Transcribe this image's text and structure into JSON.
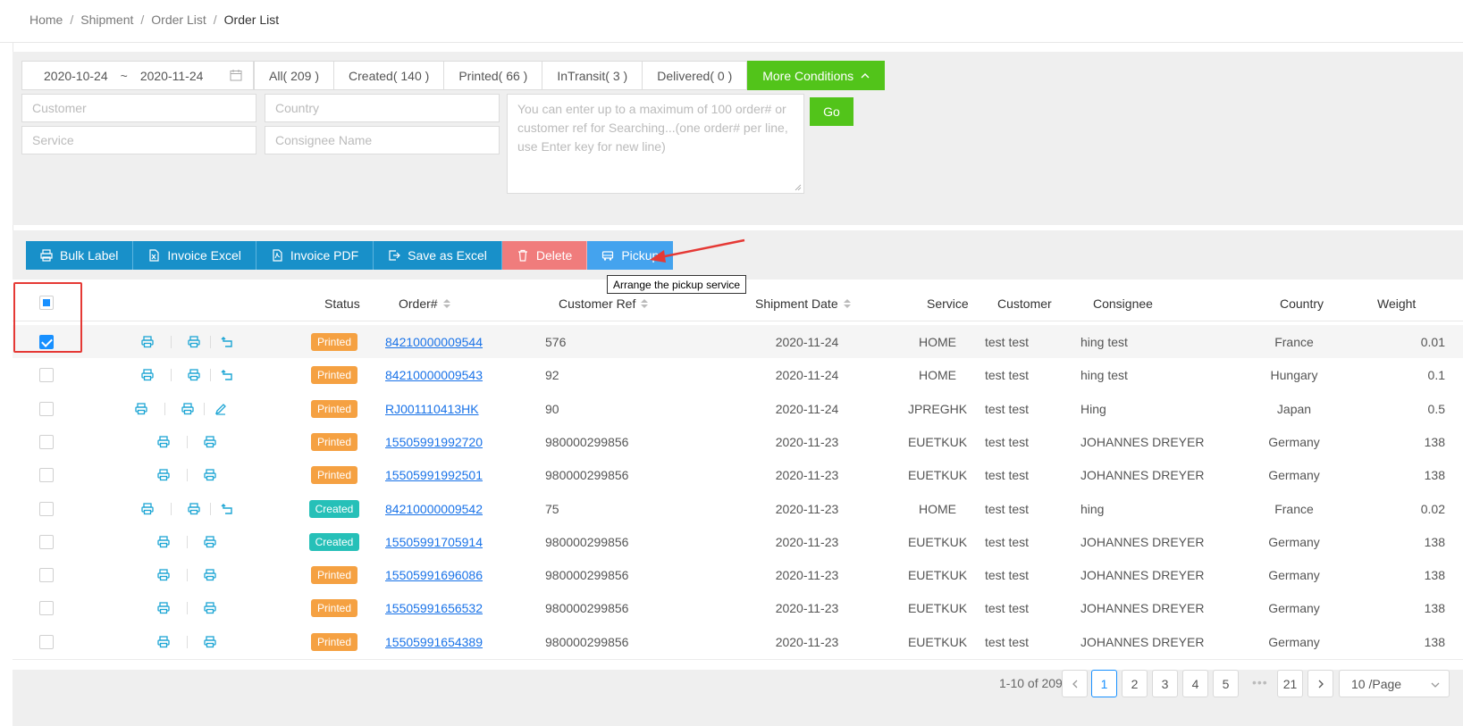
{
  "breadcrumb": [
    "Home",
    "Shipment",
    "Order List",
    "Order List"
  ],
  "filters": {
    "date_start": "2020-10-24",
    "date_sep": "~",
    "date_end": "2020-11-24",
    "tabs": [
      {
        "label": "All( 209 )"
      },
      {
        "label": "Created( 140 )"
      },
      {
        "label": "Printed( 66 )"
      },
      {
        "label": "InTransit( 3 )"
      },
      {
        "label": "Delivered( 0 )"
      }
    ],
    "more_label": "More Conditions",
    "customer_placeholder": "Customer",
    "country_placeholder": "Country",
    "service_placeholder": "Service",
    "consignee_placeholder": "Consignee Name",
    "search_placeholder": "You can enter up to a maximum of 100 order# or customer ref for Searching...(one order# per line, use Enter key for new line)",
    "go_label": "Go"
  },
  "toolbar": {
    "bulk_label": "Bulk Label",
    "invoice_excel": "Invoice Excel",
    "invoice_pdf": "Invoice PDF",
    "save_excel": "Save as Excel",
    "delete": "Delete",
    "pickup": "Pickup"
  },
  "tooltip": "Arrange the pickup service",
  "columns": {
    "status": "Status",
    "order": "Order#",
    "customer_ref": "Customer Ref",
    "shipment_date": "Shipment Date",
    "service": "Service",
    "customer": "Customer",
    "consignee": "Consignee",
    "country": "Country",
    "weight": "Weight"
  },
  "rows": [
    {
      "checked": true,
      "actions": "print-print-return",
      "status": "Printed",
      "order": "84210000009544",
      "ref": "576",
      "date": "2020-11-24",
      "service": "HOME",
      "customer": "test test",
      "consignee": "hing test",
      "country": "France",
      "weight": "0.01"
    },
    {
      "checked": false,
      "actions": "print-print-return",
      "status": "Printed",
      "order": "84210000009543",
      "ref": "92",
      "date": "2020-11-24",
      "service": "HOME",
      "customer": "test test",
      "consignee": "hing test",
      "country": "Hungary",
      "weight": "0.1"
    },
    {
      "checked": false,
      "actions": "print-print-edit",
      "status": "Printed",
      "order": "RJ001110413HK",
      "ref": "90",
      "date": "2020-11-24",
      "service": "JPREGHK",
      "customer": "test test",
      "consignee": "Hing",
      "country": "Japan",
      "weight": "0.5"
    },
    {
      "checked": false,
      "actions": "print-print",
      "status": "Printed",
      "order": "15505991992720",
      "ref": "980000299856",
      "date": "2020-11-23",
      "service": "EUETKUK",
      "customer": "test test",
      "consignee": "JOHANNES DREYER",
      "country": "Germany",
      "weight": "138"
    },
    {
      "checked": false,
      "actions": "print-print",
      "status": "Printed",
      "order": "15505991992501",
      "ref": "980000299856",
      "date": "2020-11-23",
      "service": "EUETKUK",
      "customer": "test test",
      "consignee": "JOHANNES DREYER",
      "country": "Germany",
      "weight": "138"
    },
    {
      "checked": false,
      "actions": "print-print-return",
      "status": "Created",
      "order": "84210000009542",
      "ref": "75",
      "date": "2020-11-23",
      "service": "HOME",
      "customer": "test test",
      "consignee": "hing",
      "country": "France",
      "weight": "0.02"
    },
    {
      "checked": false,
      "actions": "print-print",
      "status": "Created",
      "order": "15505991705914",
      "ref": "980000299856",
      "date": "2020-11-23",
      "service": "EUETKUK",
      "customer": "test test",
      "consignee": "JOHANNES DREYER",
      "country": "Germany",
      "weight": "138"
    },
    {
      "checked": false,
      "actions": "print-print",
      "status": "Printed",
      "order": "15505991696086",
      "ref": "980000299856",
      "date": "2020-11-23",
      "service": "EUETKUK",
      "customer": "test test",
      "consignee": "JOHANNES DREYER",
      "country": "Germany",
      "weight": "138"
    },
    {
      "checked": false,
      "actions": "print-print",
      "status": "Printed",
      "order": "15505991656532",
      "ref": "980000299856",
      "date": "2020-11-23",
      "service": "EUETKUK",
      "customer": "test test",
      "consignee": "JOHANNES DREYER",
      "country": "Germany",
      "weight": "138"
    },
    {
      "checked": false,
      "actions": "print-print",
      "status": "Printed",
      "order": "15505991654389",
      "ref": "980000299856",
      "date": "2020-11-23",
      "service": "EUETKUK",
      "customer": "test test",
      "consignee": "JOHANNES DREYER",
      "country": "Germany",
      "weight": "138"
    }
  ],
  "pagination": {
    "total": "1-10 of 209",
    "pages": [
      "1",
      "2",
      "3",
      "4",
      "5"
    ],
    "dots": "•••",
    "last": "21",
    "page_size": "10 /Page"
  },
  "colors": {
    "accent": "#52c41a",
    "toolbar": "#1890c9",
    "delete": "#f07c7c",
    "pickup": "#44a3ee",
    "printed": "#f5a142",
    "created": "#26c0b8",
    "link": "#1a73e8"
  }
}
